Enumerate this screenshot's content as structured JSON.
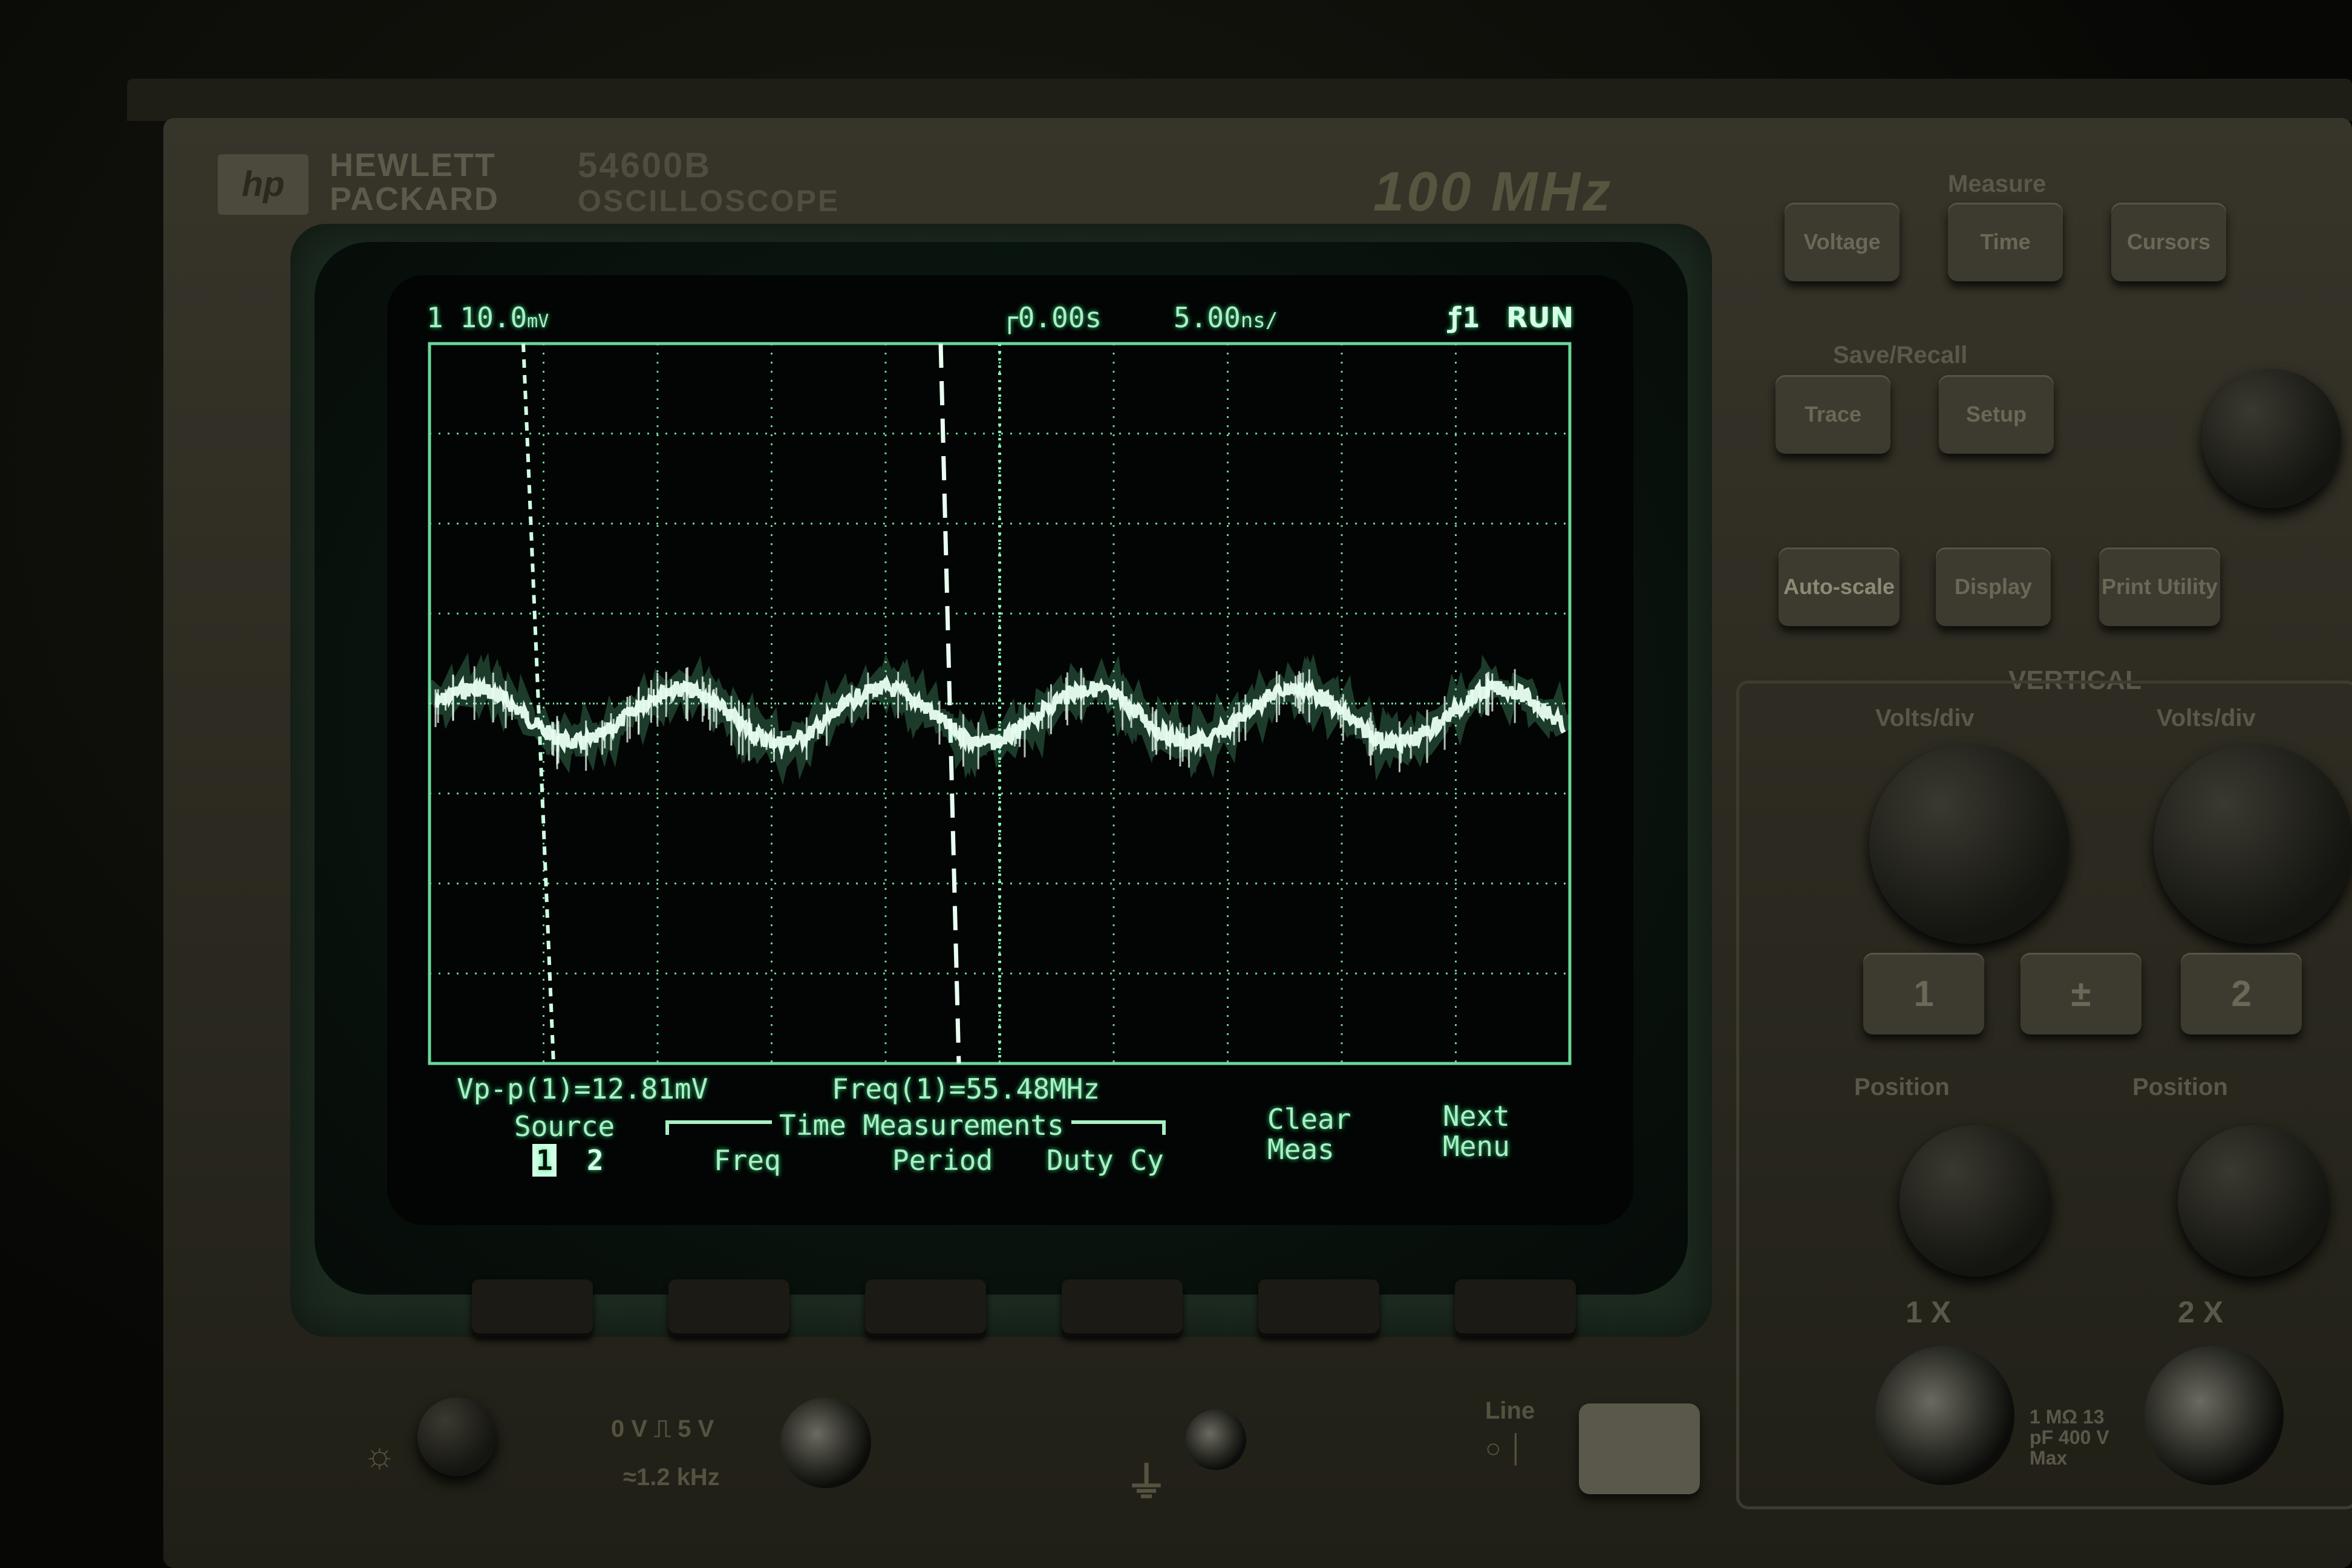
{
  "device": {
    "brand_line1": "HEWLETT",
    "brand_line2": "PACKARD",
    "logo_text": "hp",
    "model_line1": "54600B",
    "model_line2": "OSCILLOSCOPE",
    "bandwidth": "100 MHz"
  },
  "screen": {
    "channel_scale": "1  10.0",
    "channel_unit": "mV",
    "time_delay": "0.00s",
    "time_scale": "5.00",
    "time_unit": "ns/",
    "trigger_label": "ƒ1",
    "run_state": "RUN",
    "measurement_1": "Vp-p(1)=12.81mV",
    "measurement_2": "Freq(1)=55.48MHz",
    "trace_amplitude_divs": 0.3,
    "trace_cycles_on_screen": 5.5
  },
  "softkeys": {
    "source_label": "Source",
    "source_1": "1",
    "source_2": "2",
    "group_title": "Time Measurements",
    "freq": "Freq",
    "period": "Period",
    "duty": "Duty Cy",
    "clear_line1": "Clear",
    "clear_line2": "Meas",
    "next_line1": "Next",
    "next_line2": "Menu"
  },
  "panel": {
    "measure_label": "Measure",
    "measure_buttons": [
      "Voltage",
      "Time",
      "Cursors"
    ],
    "save_label": "Save/Recall",
    "save_buttons": [
      "Trace",
      "Setup"
    ],
    "autoscale": "Auto-scale",
    "display": "Display",
    "print": "Print Utility",
    "vertical_label": "VERTICAL",
    "volts_div_1": "Volts/div",
    "volts_div_2": "Volts/div",
    "ch1_key": "1",
    "math_key": "±",
    "ch2_key": "2",
    "position_1": "Position",
    "position_2": "Position",
    "input_1": "1 X",
    "input_2": "2 X",
    "input_rating": "1 MΩ 13 pF 400 V Max"
  },
  "bottom": {
    "cal_label": "0 V ⎍ 5 V",
    "cal_freq": "≈1.2 kHz",
    "line_label": "Line"
  },
  "colors": {
    "phosphor": "#a9f0c4",
    "trace": "#e9fff2",
    "grid": "#6ad79a",
    "panel": "#37352a"
  }
}
